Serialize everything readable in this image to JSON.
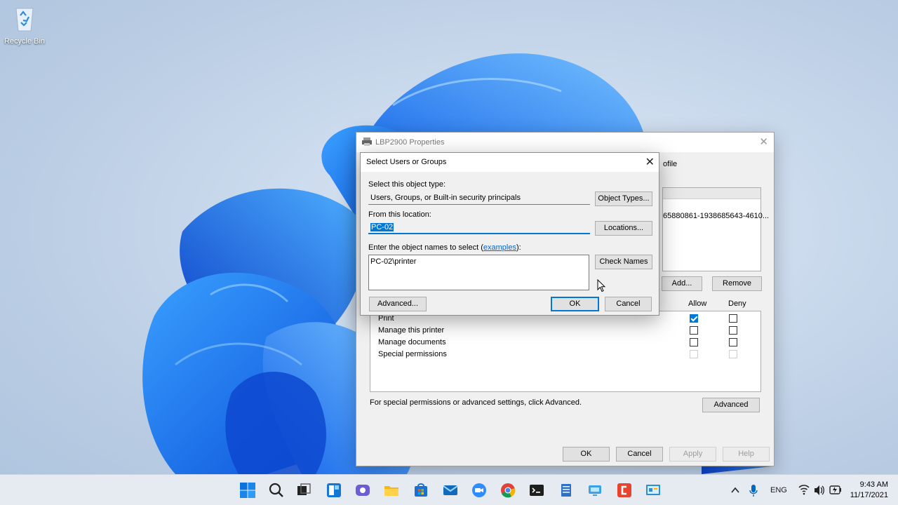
{
  "desktop": {
    "recycle_bin_label": "Recycle Bin"
  },
  "printer_window": {
    "title": "LBP2900 Properties",
    "tab_partial": "ofile",
    "user_sid_partial": "65880861-1938685643-4610...",
    "add_label": "Add...",
    "remove_label": "Remove",
    "allow_label": "Allow",
    "deny_label": "Deny",
    "permissions": [
      {
        "name": "Print",
        "allow": true,
        "deny": false,
        "enabled": true
      },
      {
        "name": "Manage this printer",
        "allow": false,
        "deny": false,
        "enabled": true
      },
      {
        "name": "Manage documents",
        "allow": false,
        "deny": false,
        "enabled": true
      },
      {
        "name": "Special permissions",
        "allow": false,
        "deny": false,
        "enabled": false
      }
    ],
    "special_note": "For special permissions or advanced settings, click Advanced.",
    "advanced_label": "Advanced",
    "ok_label": "OK",
    "cancel_label": "Cancel",
    "apply_label": "Apply",
    "help_label": "Help"
  },
  "select_dialog": {
    "title": "Select Users or Groups",
    "object_type_label": "Select this object type:",
    "object_type_value": "Users, Groups, or Built-in security principals",
    "object_types_button": "Object Types...",
    "location_label": "From this location:",
    "location_value": "PC-02",
    "locations_button": "Locations...",
    "names_label_prefix": "Enter the object names to select (",
    "names_label_link": "examples",
    "names_label_suffix": "):",
    "names_value": "PC-02\\printer",
    "check_names_button": "Check Names",
    "advanced_button": "Advanced...",
    "ok_button": "OK",
    "cancel_button": "Cancel"
  },
  "taskbar": {
    "tray_language": "ENG",
    "time": "9:43 AM",
    "date": "11/17/2021",
    "apps": [
      "start-icon",
      "search-icon",
      "task-view-icon",
      "widgets-icon",
      "chat-icon",
      "file-explorer-icon",
      "store-icon",
      "mail-icon",
      "zoom-icon",
      "chrome-icon",
      "terminal-icon",
      "notepad-icon",
      "remote-desktop-icon",
      "app-icon",
      "control-panel-icon"
    ]
  }
}
